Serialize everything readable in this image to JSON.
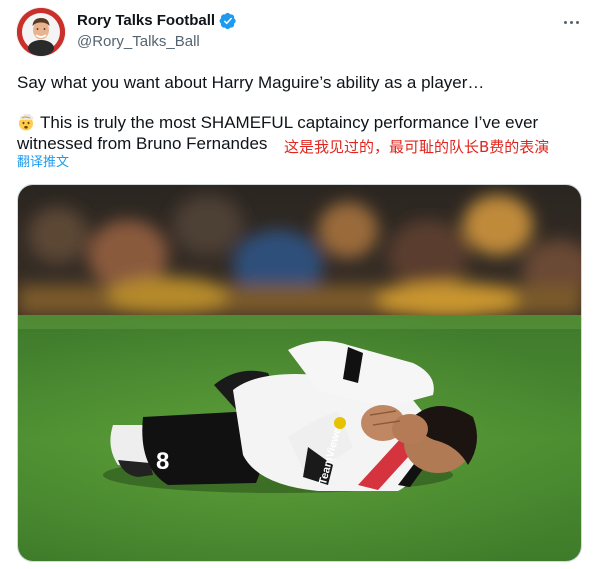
{
  "author": {
    "display_name": "Rory Talks Football",
    "handle": "@Rory_Talks_Ball",
    "verified": true
  },
  "tweet": {
    "line1": "Say what you want about Harry Maguire’s ability as a player…",
    "line2": "This is truly the most SHAMEFUL captaincy performance I’ve ever",
    "line3": "witnessed from Bruno Fernandes",
    "annotation": "这是我见过的，最可耻的队长B费的表演",
    "translate_label": "翻译推文"
  },
  "media": {
    "shirt_number": "8",
    "sponsor_text": "TeamViewer"
  },
  "icons": {
    "verified": "verified-badge-icon",
    "more": "more-options-icon",
    "emoji": "exploding-head-emoji"
  },
  "colors": {
    "accent": "#1d9bf0",
    "text": "#0f1419",
    "muted": "#536471",
    "annotation": "#e0261e"
  }
}
